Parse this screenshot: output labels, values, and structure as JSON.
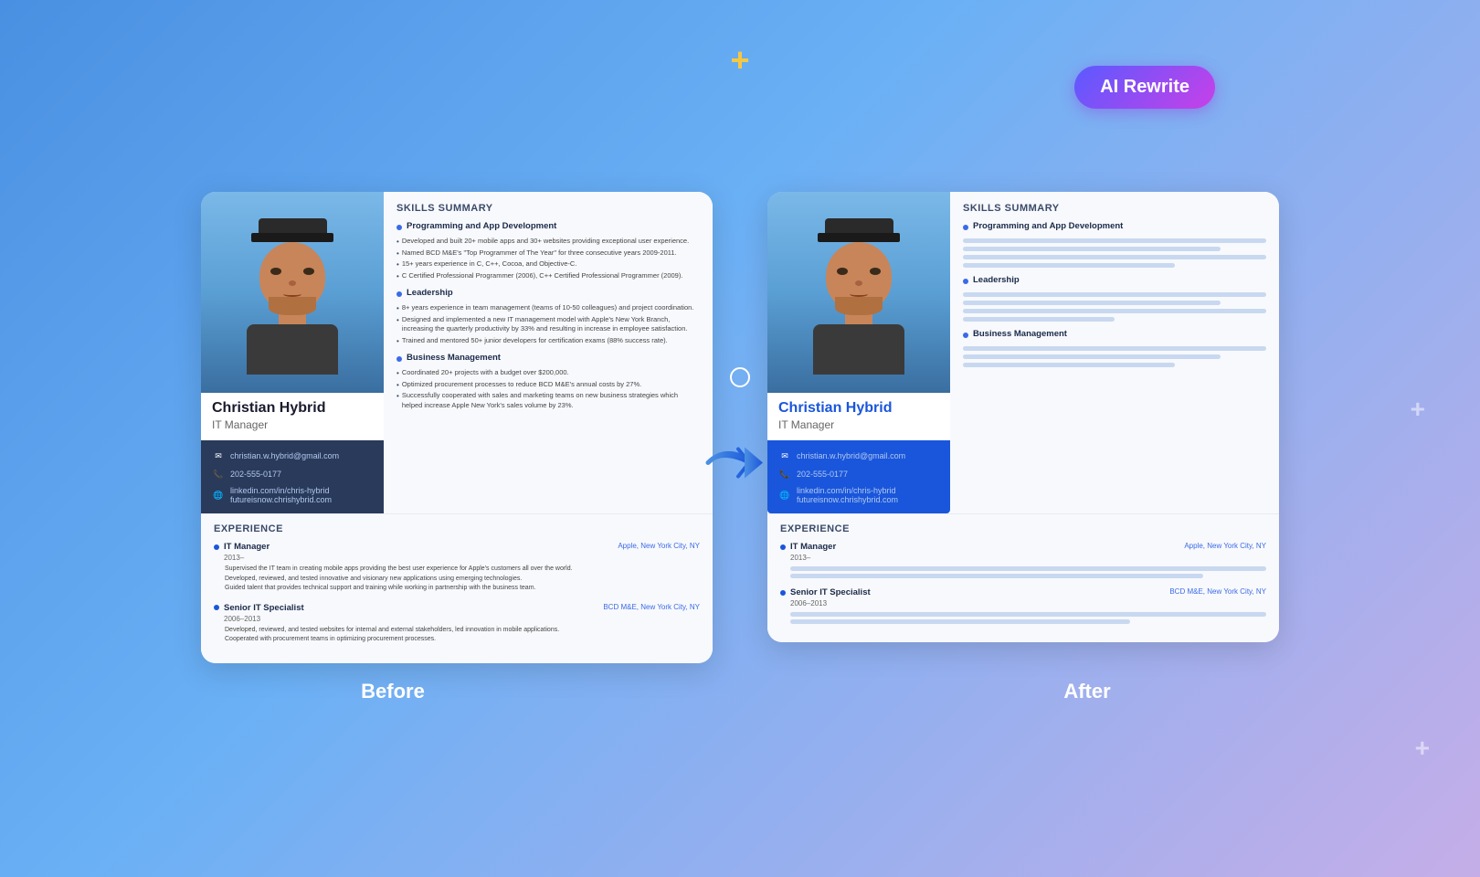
{
  "background": {
    "gradient_start": "#4a90e2",
    "gradient_end": "#c5aee8"
  },
  "ai_badge": {
    "label": "AI Rewrite"
  },
  "labels": {
    "before": "Before",
    "after": "After"
  },
  "person": {
    "name": "Christian Hybrid",
    "title": "IT Manager",
    "email": "christian.w.hybrid@gmail.com",
    "phone": "202-555-0177",
    "linkedin": "linkedin.com/in/chris-hybrid",
    "website": "futureisnow.chrishybrid.com"
  },
  "skills": {
    "section_title": "SKILLS SUMMARY",
    "items": [
      {
        "title": "Programming and App Development",
        "bullets": [
          "Developed and built 20+ mobile apps and 30+ websites providing exceptional user experience.",
          "Named BCD M&E's \"Top Programmer of The Year\" for three consecutive years 2009-2011.",
          "15+ years experience in C, C++, Cocoa, and Objective-C.",
          "C Certified Professional Programmer (2006), C++ Certified Professional Programmer (2009)."
        ]
      },
      {
        "title": "Leadership",
        "bullets": [
          "8+ years experience in team management (teams of 10-50 colleagues) and project coordination.",
          "Designed and implemented a new IT management model with Apple's New York Branch, increasing the quarterly productivity by 33% and resulting in increase in employee satisfaction.",
          "Trained and mentored 50+ junior developers for certification exams (88% success rate)."
        ]
      },
      {
        "title": "Business Management",
        "bullets": [
          "Coordinated 20+ projects with a budget over $200,000.",
          "Optimized procurement processes to reduce BCD M&E's annual costs by 27%.",
          "Successfully cooperated with sales and marketing teams on new business strategies which helped increase Apple New York's sales volume by 23%."
        ]
      }
    ]
  },
  "experience": {
    "section_title": "EXPERIENCE",
    "items": [
      {
        "title": "IT Manager",
        "dates": "2013–",
        "company": "Apple, New York City, NY",
        "bullets": [
          "Supervised the IT team in creating mobile apps providing the best user experience for Apple's customers all over the world.",
          "Developed, reviewed, and tested innovative and visionary new applications using emerging technologies.",
          "Guided talent that provides technical support and training while working in partnership with the business team."
        ]
      },
      {
        "title": "Senior IT Specialist",
        "dates": "2006–2013",
        "company": "BCD M&E, New York City, NY",
        "bullets": [
          "Developed, reviewed, and tested websites for internal and external stakeholders, led innovation in mobile applications.",
          "Cooperated with procurement teams in optimizing procurement processes."
        ]
      }
    ]
  },
  "decorators": {
    "plus_top": "+",
    "plus_right_mid": "+",
    "plus_right_bottom": "+"
  }
}
